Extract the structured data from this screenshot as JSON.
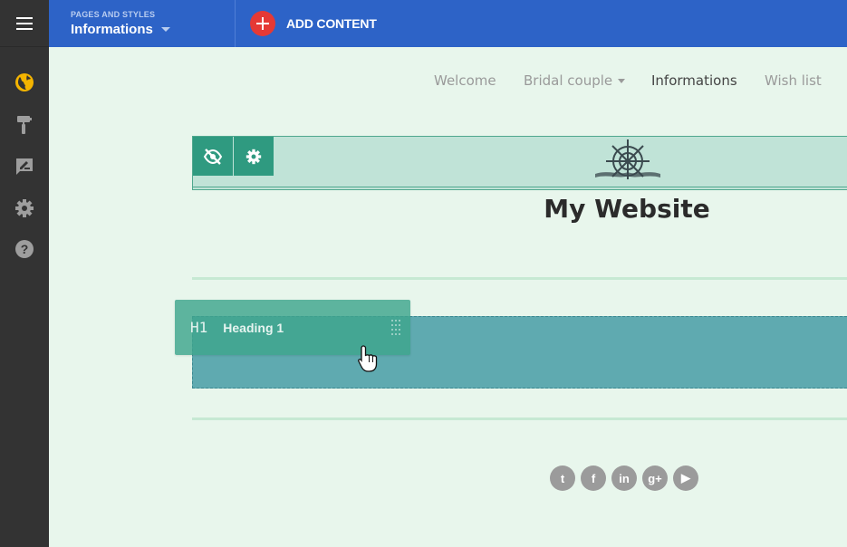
{
  "topbar": {
    "pages_label": "PAGES AND STYLES",
    "pages_value": "Informations",
    "add_content_label": "ADD CONTENT",
    "brand_color": "#2d63c7",
    "add_button_color": "#e53935"
  },
  "sidebar": {
    "menu_icon": "hamburger-icon",
    "items": [
      {
        "icon": "globe-icon",
        "active": true,
        "color": "#f4b400"
      },
      {
        "icon": "paint-roller-icon",
        "active": false
      },
      {
        "icon": "edit-comment-icon",
        "active": false
      },
      {
        "icon": "gear-icon",
        "active": false
      },
      {
        "icon": "help-icon",
        "active": false
      }
    ]
  },
  "site_nav": {
    "items": [
      "Welcome",
      "Bridal couple",
      "Informations",
      "Wish list"
    ],
    "active": "Informations"
  },
  "header": {
    "site_title": "My Website",
    "toolbar_icons": [
      "eye-off-icon",
      "gear-icon"
    ],
    "logo": "ship-wheel-logo"
  },
  "drag_item": {
    "tag": "H1",
    "label": "Heading 1"
  },
  "social": [
    "twitter-icon",
    "facebook-icon",
    "linkedin-icon",
    "google-plus-icon",
    "youtube-icon"
  ],
  "social_glyphs": {
    "twitter": "t",
    "facebook": "f",
    "linkedin": "in",
    "google_plus": "g+",
    "youtube": "▶"
  }
}
